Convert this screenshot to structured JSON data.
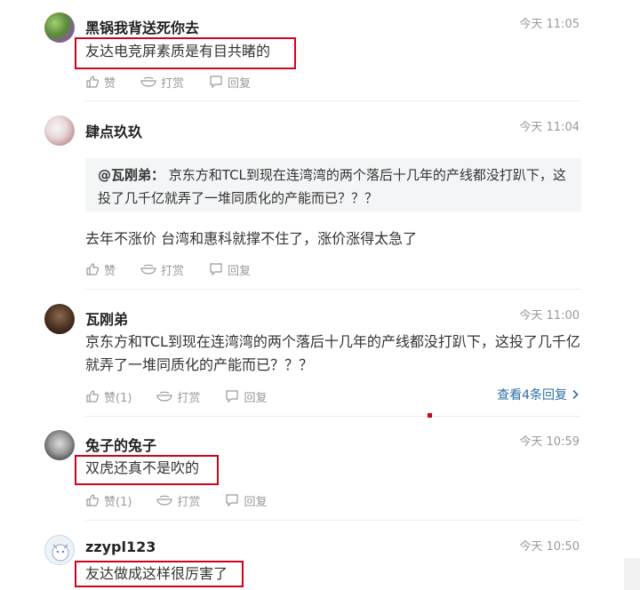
{
  "comments": [
    {
      "username": "黑锅我背送死你去",
      "time": "今天 11:05",
      "text": "友达电竞屏素质是有目共睹的",
      "actions": {
        "like": "赞",
        "tip": "打赏",
        "reply": "回复"
      }
    },
    {
      "username": "肆点玖玖",
      "time": "今天 11:04",
      "quote": {
        "author": "@瓦刚弟：",
        "line1": " 京东方和TCL到现在连湾湾的两个落后十几年的产线都没打趴下，这",
        "line2": "投了几千亿就弄了一堆同质化的产能而已？？？"
      },
      "text": "去年不涨价 台湾和惠科就撑不住了，涨价涨得太急了",
      "actions": {
        "like": "赞",
        "tip": "打赏",
        "reply": "回复"
      }
    },
    {
      "username": "瓦刚弟",
      "time": "今天 11:00",
      "text_line1": "京东方和TCL到现在连湾湾的两个落后十几年的产线都没打趴下，这投了几千亿",
      "text_line2": "就弄了一堆同质化的产能而已？？？",
      "actions": {
        "like": "赞(1)",
        "tip": "打赏",
        "reply": "回复"
      },
      "more_replies": "查看4条回复"
    },
    {
      "username": "兔子的兔子",
      "time": "今天 10:59",
      "text": "双虎还真不是吹的",
      "actions": {
        "like": "赞(1)",
        "tip": "打赏",
        "reply": "回复"
      }
    },
    {
      "username": "zzypl123",
      "time": "今天 10:50",
      "text": "友达做成这样很厉害了"
    }
  ],
  "colors": {
    "highlight_box": "#d0021b",
    "link": "#2d6ea8",
    "muted": "#999999"
  },
  "icons": {
    "like": "thumbs-up-icon",
    "tip": "tip-bowl-icon",
    "reply": "comment-bubble-icon",
    "more": "chevron-right-icon"
  }
}
